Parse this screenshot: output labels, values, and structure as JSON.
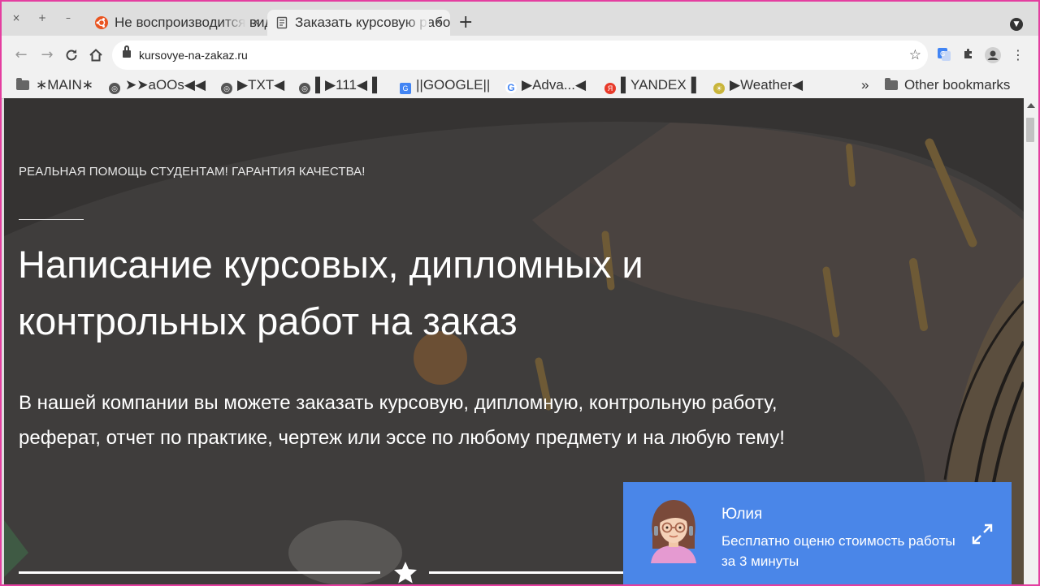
{
  "browser": {
    "window_controls": {
      "close": "×",
      "maximize": "+",
      "minimize": "–"
    },
    "tabs": [
      {
        "title": "Не воспроизводится видео",
        "icon": "ubuntu-icon",
        "active": false
      },
      {
        "title": "Заказать курсовую работу",
        "icon": "document-icon",
        "active": true
      }
    ],
    "new_tab": "+",
    "url": "kursovye-na-zakaz.ru",
    "bookmarks": [
      {
        "label": "∗MAIN∗",
        "icon": "folder-icon"
      },
      {
        "label": "➤➤aOOs◀◀",
        "icon": "globe-icon"
      },
      {
        "label": "▶TXT◀",
        "icon": "globe-icon"
      },
      {
        "label": "▌▶111◀▐",
        "icon": "globe-icon"
      },
      {
        "label": "||GOOGLE||",
        "icon": "google-translate-icon"
      },
      {
        "label": "▶Adva...◀",
        "icon": "google-icon"
      },
      {
        "label": "▌YANDEX▐",
        "icon": "yandex-icon"
      },
      {
        "label": "▶Weather◀",
        "icon": "weather-icon"
      }
    ],
    "bookmarks_overflow": "»",
    "other_bookmarks": "Other bookmarks"
  },
  "hero": {
    "eyebrow": "РЕАЛЬНАЯ ПОМОЩЬ СТУДЕНТАМ! ГАРАНТИЯ КАЧЕСТВА!",
    "headline": "Написание курсовых, дипломных и контрольных работ на заказ",
    "lead": "В нашей компании вы можете заказать курсовую, дипломную, контрольную работу, реферат, отчет по практике, чертеж или эссе по любому предмету и на любую тему!"
  },
  "chat": {
    "name": "Юлия",
    "message": "Бесплатно оценю стоимость работы за 3 минуты"
  },
  "colors": {
    "accent_frame": "#e43ea0",
    "chat_bg": "#4a86e8",
    "hero_overlay": "#3d3b3a"
  }
}
